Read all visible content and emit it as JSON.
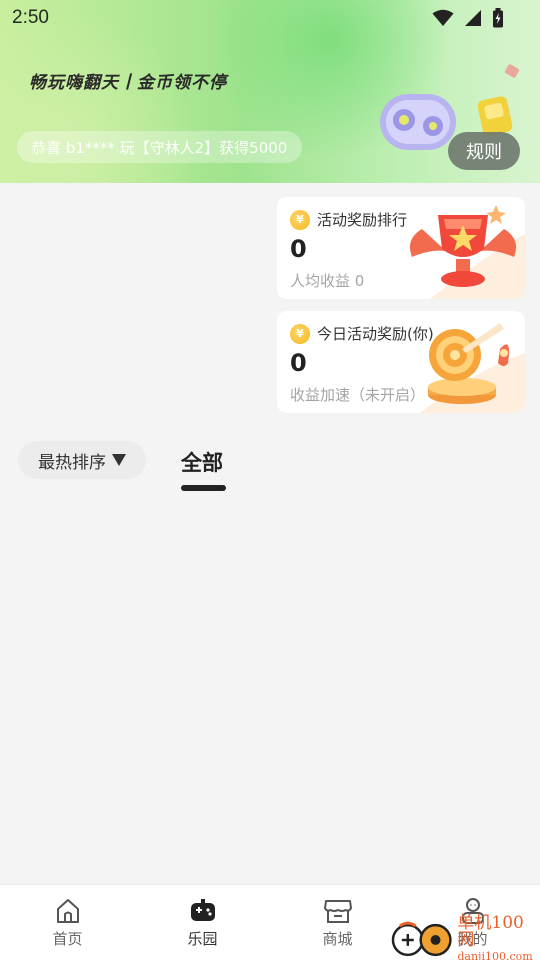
{
  "status": {
    "time": "2:50",
    "icons": [
      "wifi-icon",
      "signal-icon",
      "battery-icon"
    ]
  },
  "banner": {
    "slogan": "畅玩嗨翻天丨金币领不停",
    "ticker": "恭喜 b1**** 玩【守林人2】获得5000",
    "rules_label": "规则"
  },
  "cards": [
    {
      "title": "活动奖励排行",
      "value": "0",
      "sub": "人均收益 0",
      "art": "trophy-icon"
    },
    {
      "title": "今日活动奖励(你)",
      "value": "0",
      "sub": "收益加速（未开启）",
      "art": "target-icon"
    }
  ],
  "filters": {
    "sort_label": "最热排序",
    "tab_all": "全部"
  },
  "bottom_nav": [
    {
      "label": "首页",
      "icon": "home-icon",
      "active": false
    },
    {
      "label": "乐园",
      "icon": "gamepad-icon",
      "active": true
    },
    {
      "label": "商城",
      "icon": "store-icon",
      "active": false
    },
    {
      "label": "我的",
      "icon": "profile-icon",
      "active": false
    }
  ],
  "watermark": {
    "line1": "单机100网",
    "line2": "danji100.com"
  },
  "colors": {
    "banner_green": "#a8e68f",
    "coin_gold": "#f5b51c",
    "accent_dark": "#222222",
    "watermark_orange": "#e8612c"
  }
}
